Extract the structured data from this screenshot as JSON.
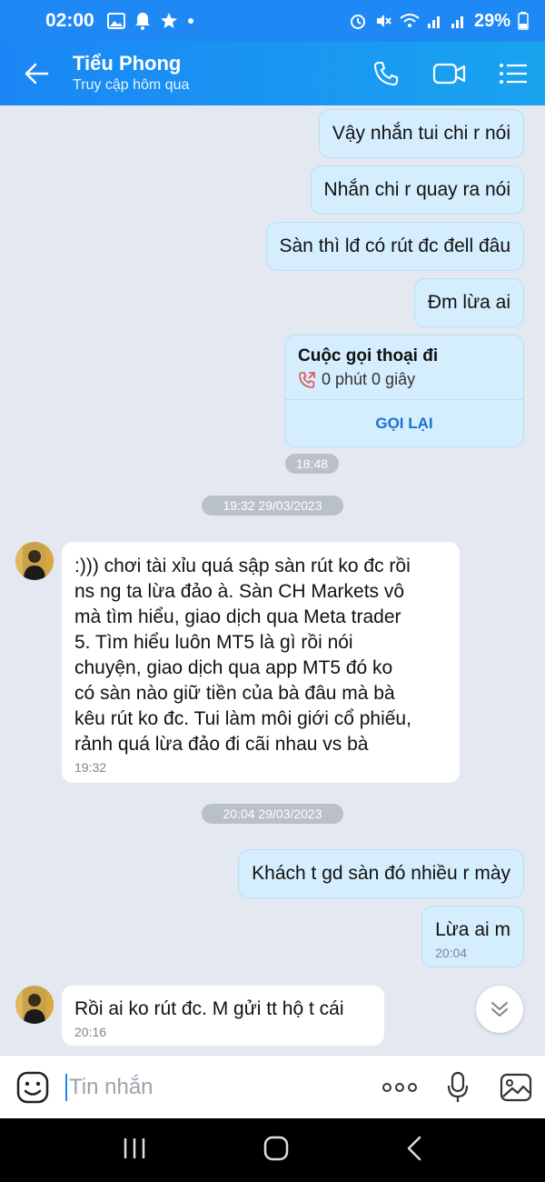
{
  "status_bar": {
    "time": "02:00",
    "battery": "29%"
  },
  "header": {
    "name": "Tiểu Phong",
    "subtitle": "Truy cập hôm qua"
  },
  "messages": {
    "m1": "Vậy nhắn tui chi r nói",
    "m2": "Nhắn chi r quay ra nói",
    "m3": "Sàn thì lđ có rút đc đell đâu",
    "m4": "Đm lừa ai",
    "call": {
      "title": "Cuộc gọi thoại đi",
      "duration": "0 phút 0 giây",
      "action": "GỌI LẠI",
      "time": "18:48"
    },
    "sep1": "19:32 29/03/2023",
    "in1": {
      "lines": [
        ":))) chơi tài xỉu quá sập sàn rút ko đc rồi",
        "ns ng ta lừa đảo à. Sàn CH Markets vô",
        "mà tìm hiểu, giao dịch qua Meta trader",
        "5. Tìm hiểu luôn MT5 là gì rồi nói",
        "chuyện, giao dịch qua app MT5 đó ko",
        "có sàn nào giữ tiền của bà đâu mà bà",
        "kêu rút ko đc. Tui làm môi giới cổ phiếu,",
        "rảnh quá lừa đảo đi cãi nhau vs bà"
      ],
      "time": "19:32"
    },
    "sep2": "20:04 29/03/2023",
    "m5": "Khách t gd sàn đó nhiều r mày",
    "m6": {
      "text": "Lừa ai m",
      "time": "20:04"
    },
    "in2": {
      "text": "Rồi ai ko rút đc. M gửi tt hộ t cái",
      "time": "20:16"
    }
  },
  "composer": {
    "placeholder": "Tin nhắn"
  },
  "colors": {
    "header_start": "#1a86f5",
    "header_end": "#19a4ef",
    "chat_bg": "#e4e9f1",
    "outgoing_bubble": "#d5eefd",
    "incoming_bubble": "#ffffff",
    "accent": "#1a6fd6"
  },
  "icons": {
    "back": "arrow-left-icon",
    "call": "phone-icon",
    "video": "video-camera-icon",
    "menu": "list-menu-icon",
    "emoji": "emoji-icon",
    "more": "more-dots-icon",
    "mic": "microphone-icon",
    "image": "image-icon",
    "scroll": "chevron-double-down-icon"
  }
}
